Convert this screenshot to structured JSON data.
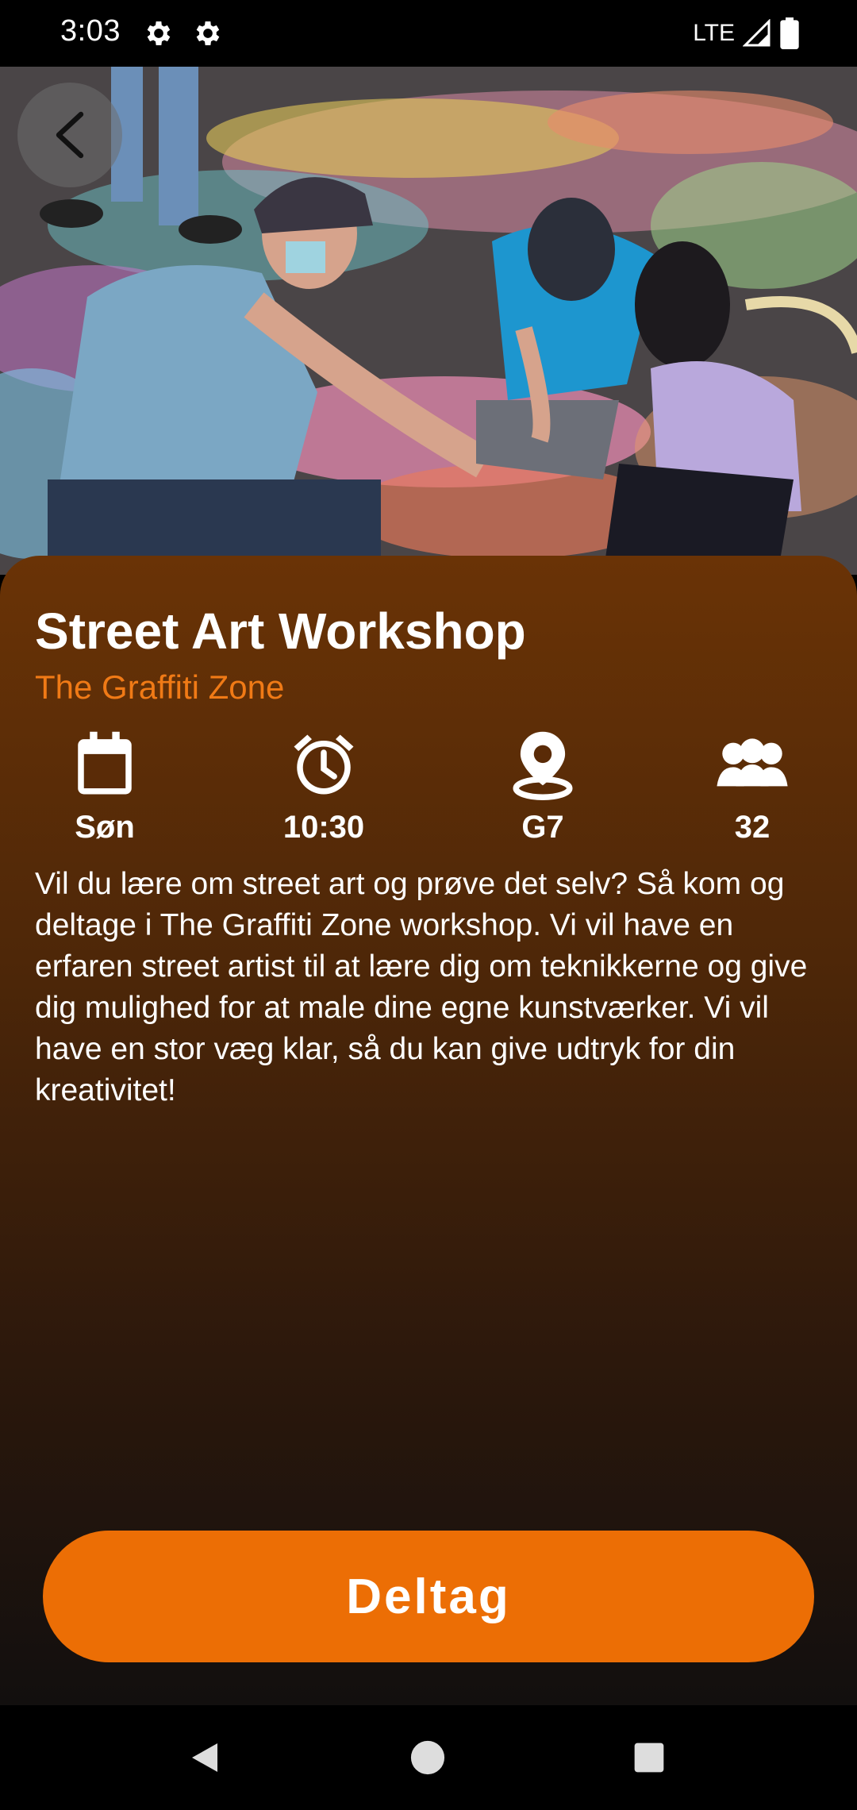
{
  "status_bar": {
    "time": "3:03",
    "network": "LTE",
    "icons": [
      "settings-gear-icon",
      "settings-gear-icon",
      "signal-icon",
      "battery-icon"
    ]
  },
  "hero": {
    "icon_back": "chevron-left-icon"
  },
  "event": {
    "title": "Street Art Workshop",
    "location_name": "The Graffiti Zone",
    "day": "Søn",
    "time": "10:30",
    "room": "G7",
    "participants": "32",
    "description": "Vil du lære om street art og prøve det selv? Så kom og deltage i The Graffiti Zone workshop. Vi vil have en erfaren street artist til at lære dig om teknikkerne og give dig mulighed for at male dine egne kunstværker. Vi vil have en stor væg klar, så du kan give udtryk for din kreativitet!"
  },
  "actions": {
    "join_label": "Deltag"
  },
  "colors": {
    "accent": "#ec6e05",
    "subtitle": "#f07a16",
    "card_top": "#6a3306",
    "card_bottom": "#120f0e"
  },
  "nav": {
    "icons": [
      "back-triangle-icon",
      "home-circle-icon",
      "recents-square-icon"
    ]
  }
}
